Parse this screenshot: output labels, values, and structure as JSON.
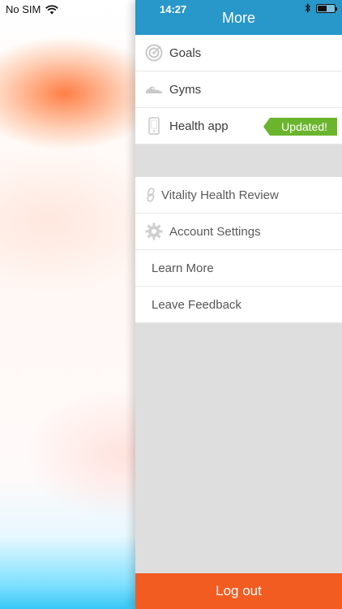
{
  "status": {
    "carrier": "No SIM",
    "time": "14:27"
  },
  "header": {
    "title": "More"
  },
  "menu_primary": [
    {
      "label": "Goals",
      "icon": "target-icon"
    },
    {
      "label": "Gyms",
      "icon": "sneaker-icon"
    },
    {
      "label": "Health app",
      "icon": "phone-icon",
      "badge": "Updated!"
    }
  ],
  "menu_secondary": [
    {
      "label": "Vitality Health Review",
      "icon": "link-icon"
    },
    {
      "label": "Account Settings",
      "icon": "gear-icon"
    },
    {
      "label": "Learn More"
    },
    {
      "label": "Leave Feedback"
    }
  ],
  "footer": {
    "logout_label": "Log out"
  },
  "colors": {
    "header_bg": "#2897c9",
    "badge_bg": "#6bb42e",
    "logout_bg": "#f25c21",
    "drawer_bg": "#dedede"
  }
}
